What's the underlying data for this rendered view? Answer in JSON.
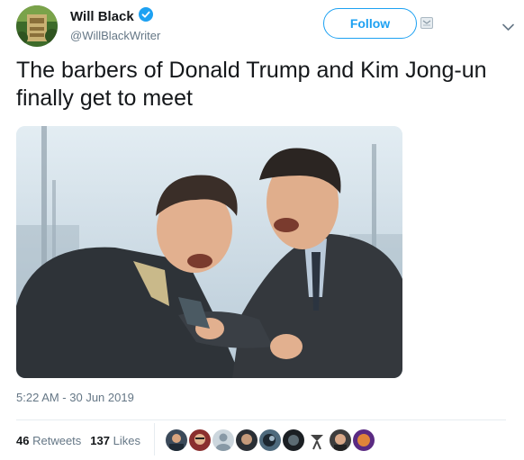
{
  "author": {
    "name": "Will Black",
    "handle": "@WillBlackWriter",
    "verified": true
  },
  "follow_label": "Follow",
  "icons": {
    "verified": "verified-badge-icon",
    "dm": "direct-message-icon",
    "menu": "chevron-down-icon"
  },
  "tweet": {
    "text": "The barbers of Donald Trump and Kim Jong-un finally get to meet"
  },
  "timestamp": "5:22 AM - 30 Jun 2019",
  "stats": {
    "retweets_count": "46",
    "retweets_label": "Retweets",
    "likes_count": "137",
    "likes_label": "Likes"
  },
  "colors": {
    "accent": "#1da1f2",
    "text": "#14171a",
    "secondary": "#657786"
  }
}
